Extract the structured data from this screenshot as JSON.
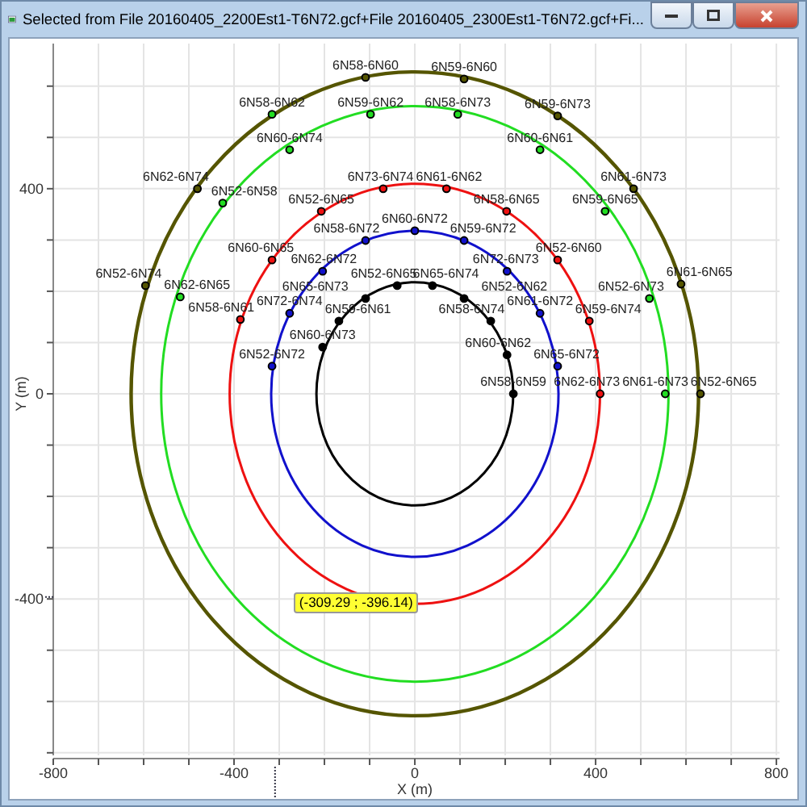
{
  "window": {
    "title": "Selected from File 20160405_2200Est1-T6N72.gcf+File 20160405_2300Est1-T6N72.gcf+Fi..."
  },
  "chart_data": {
    "type": "scatter",
    "xlabel": "X (m)",
    "ylabel": "Y (m)",
    "xlim": [
      -800,
      807
    ],
    "ylim": [
      -705,
      683
    ],
    "grid": true,
    "xticks": [
      -800,
      -400,
      0,
      400,
      800
    ],
    "yticks": [
      -400,
      0,
      400
    ],
    "series": [
      {
        "color": "#555500",
        "x": [
          -109,
          109,
          316,
          -481,
          484,
          -596,
          589,
          632
        ],
        "values": [
          617,
          614,
          542,
          400,
          400,
          211,
          214,
          0
        ]
      },
      {
        "color": "#22dd22",
        "x": [
          -316,
          -98,
          95,
          -277,
          277,
          -425,
          421,
          -519,
          519,
          554
        ],
        "values": [
          545,
          545,
          545,
          476,
          476,
          372,
          356,
          189,
          186,
          0
        ]
      },
      {
        "color": "#ee1111",
        "x": [
          -70,
          70,
          -207,
          203,
          -316,
          316,
          -386,
          386,
          410
        ],
        "values": [
          400,
          400,
          356,
          356,
          261,
          261,
          145,
          142,
          0
        ]
      },
      {
        "color": "#1111cc",
        "x": [
          0,
          -109,
          109,
          -204,
          204,
          -277,
          277,
          -316,
          316
        ],
        "values": [
          318,
          299,
          299,
          239,
          239,
          157,
          157,
          54,
          54
        ]
      },
      {
        "color": "#000000",
        "x": [
          -39,
          39,
          -109,
          109,
          -168,
          168,
          -204,
          204,
          218
        ],
        "values": [
          211,
          211,
          186,
          186,
          142,
          142,
          91,
          76,
          0
        ]
      }
    ],
    "annotations": [
      {
        "x": -109,
        "y": 617,
        "text": "6N58-6N60"
      },
      {
        "x": 109,
        "y": 614,
        "text": "6N59-6N60"
      },
      {
        "x": 316,
        "y": 542,
        "text": "6N59-6N73"
      },
      {
        "x": -481,
        "y": 400,
        "text": "6N62-6N74"
      },
      {
        "x": 484,
        "y": 400,
        "text": "6N61-6N73"
      },
      {
        "x": -596,
        "y": 211,
        "text": "6N52-6N74"
      },
      {
        "x": 589,
        "y": 214,
        "text": "6N61-6N65"
      },
      {
        "x": 632,
        "y": 0,
        "text": "6N52-6N65"
      },
      {
        "x": -316,
        "y": 545,
        "text": "6N58-6N62"
      },
      {
        "x": -98,
        "y": 545,
        "text": "6N59-6N62"
      },
      {
        "x": 95,
        "y": 545,
        "text": "6N58-6N73"
      },
      {
        "x": -277,
        "y": 476,
        "text": "6N60-6N74"
      },
      {
        "x": 277,
        "y": 476,
        "text": "6N60-6N61"
      },
      {
        "x": -425,
        "y": 372,
        "text": "6N52-6N58"
      },
      {
        "x": 421,
        "y": 356,
        "text": "6N59-6N65"
      },
      {
        "x": -519,
        "y": 189,
        "text": "6N62-6N65"
      },
      {
        "x": 519,
        "y": 186,
        "text": "6N52-6N73"
      },
      {
        "x": 554,
        "y": 0,
        "text": "6N61-6N73"
      },
      {
        "x": -70,
        "y": 400,
        "text": "6N73-6N74"
      },
      {
        "x": 70,
        "y": 400,
        "text": "6N61-6N62"
      },
      {
        "x": -207,
        "y": 356,
        "text": "6N52-6N65"
      },
      {
        "x": 203,
        "y": 356,
        "text": "6N58-6N65"
      },
      {
        "x": -316,
        "y": 261,
        "text": "6N60-6N65"
      },
      {
        "x": 316,
        "y": 261,
        "text": "6N52-6N60"
      },
      {
        "x": -386,
        "y": 145,
        "text": "6N58-6N61"
      },
      {
        "x": 386,
        "y": 142,
        "text": "6N59-6N74"
      },
      {
        "x": 410,
        "y": 0,
        "text": "6N62-6N73"
      },
      {
        "x": 0,
        "y": 318,
        "text": "6N60-6N72"
      },
      {
        "x": -109,
        "y": 299,
        "text": "6N58-6N72"
      },
      {
        "x": 109,
        "y": 299,
        "text": "6N59-6N72"
      },
      {
        "x": -204,
        "y": 239,
        "text": "6N62-6N72"
      },
      {
        "x": 204,
        "y": 239,
        "text": "6N72-6N73"
      },
      {
        "x": -277,
        "y": 157,
        "text": "6N72-6N74"
      },
      {
        "x": 277,
        "y": 157,
        "text": "6N61-6N72"
      },
      {
        "x": -316,
        "y": 54,
        "text": "6N52-6N72"
      },
      {
        "x": 316,
        "y": 54,
        "text": "6N65-6N72"
      },
      {
        "x": -39,
        "y": 211,
        "text": "6N52-6N65"
      },
      {
        "x": 39,
        "y": 211,
        "text": "6N65-6N74"
      },
      {
        "x": -109,
        "y": 186,
        "text": "6N65-6N73"
      },
      {
        "x": 109,
        "y": 186,
        "text": "6N52-6N62"
      },
      {
        "x": -168,
        "y": 142,
        "text": "6N59-6N61"
      },
      {
        "x": 168,
        "y": 142,
        "text": "6N58-6N74"
      },
      {
        "x": -204,
        "y": 91,
        "text": "6N60-6N73"
      },
      {
        "x": 204,
        "y": 76,
        "text": "6N60-6N62"
      },
      {
        "x": 218,
        "y": 0,
        "text": "6N58-6N59"
      }
    ]
  },
  "cursor_readout": {
    "text": "(-309.29 ; -396.14)"
  }
}
